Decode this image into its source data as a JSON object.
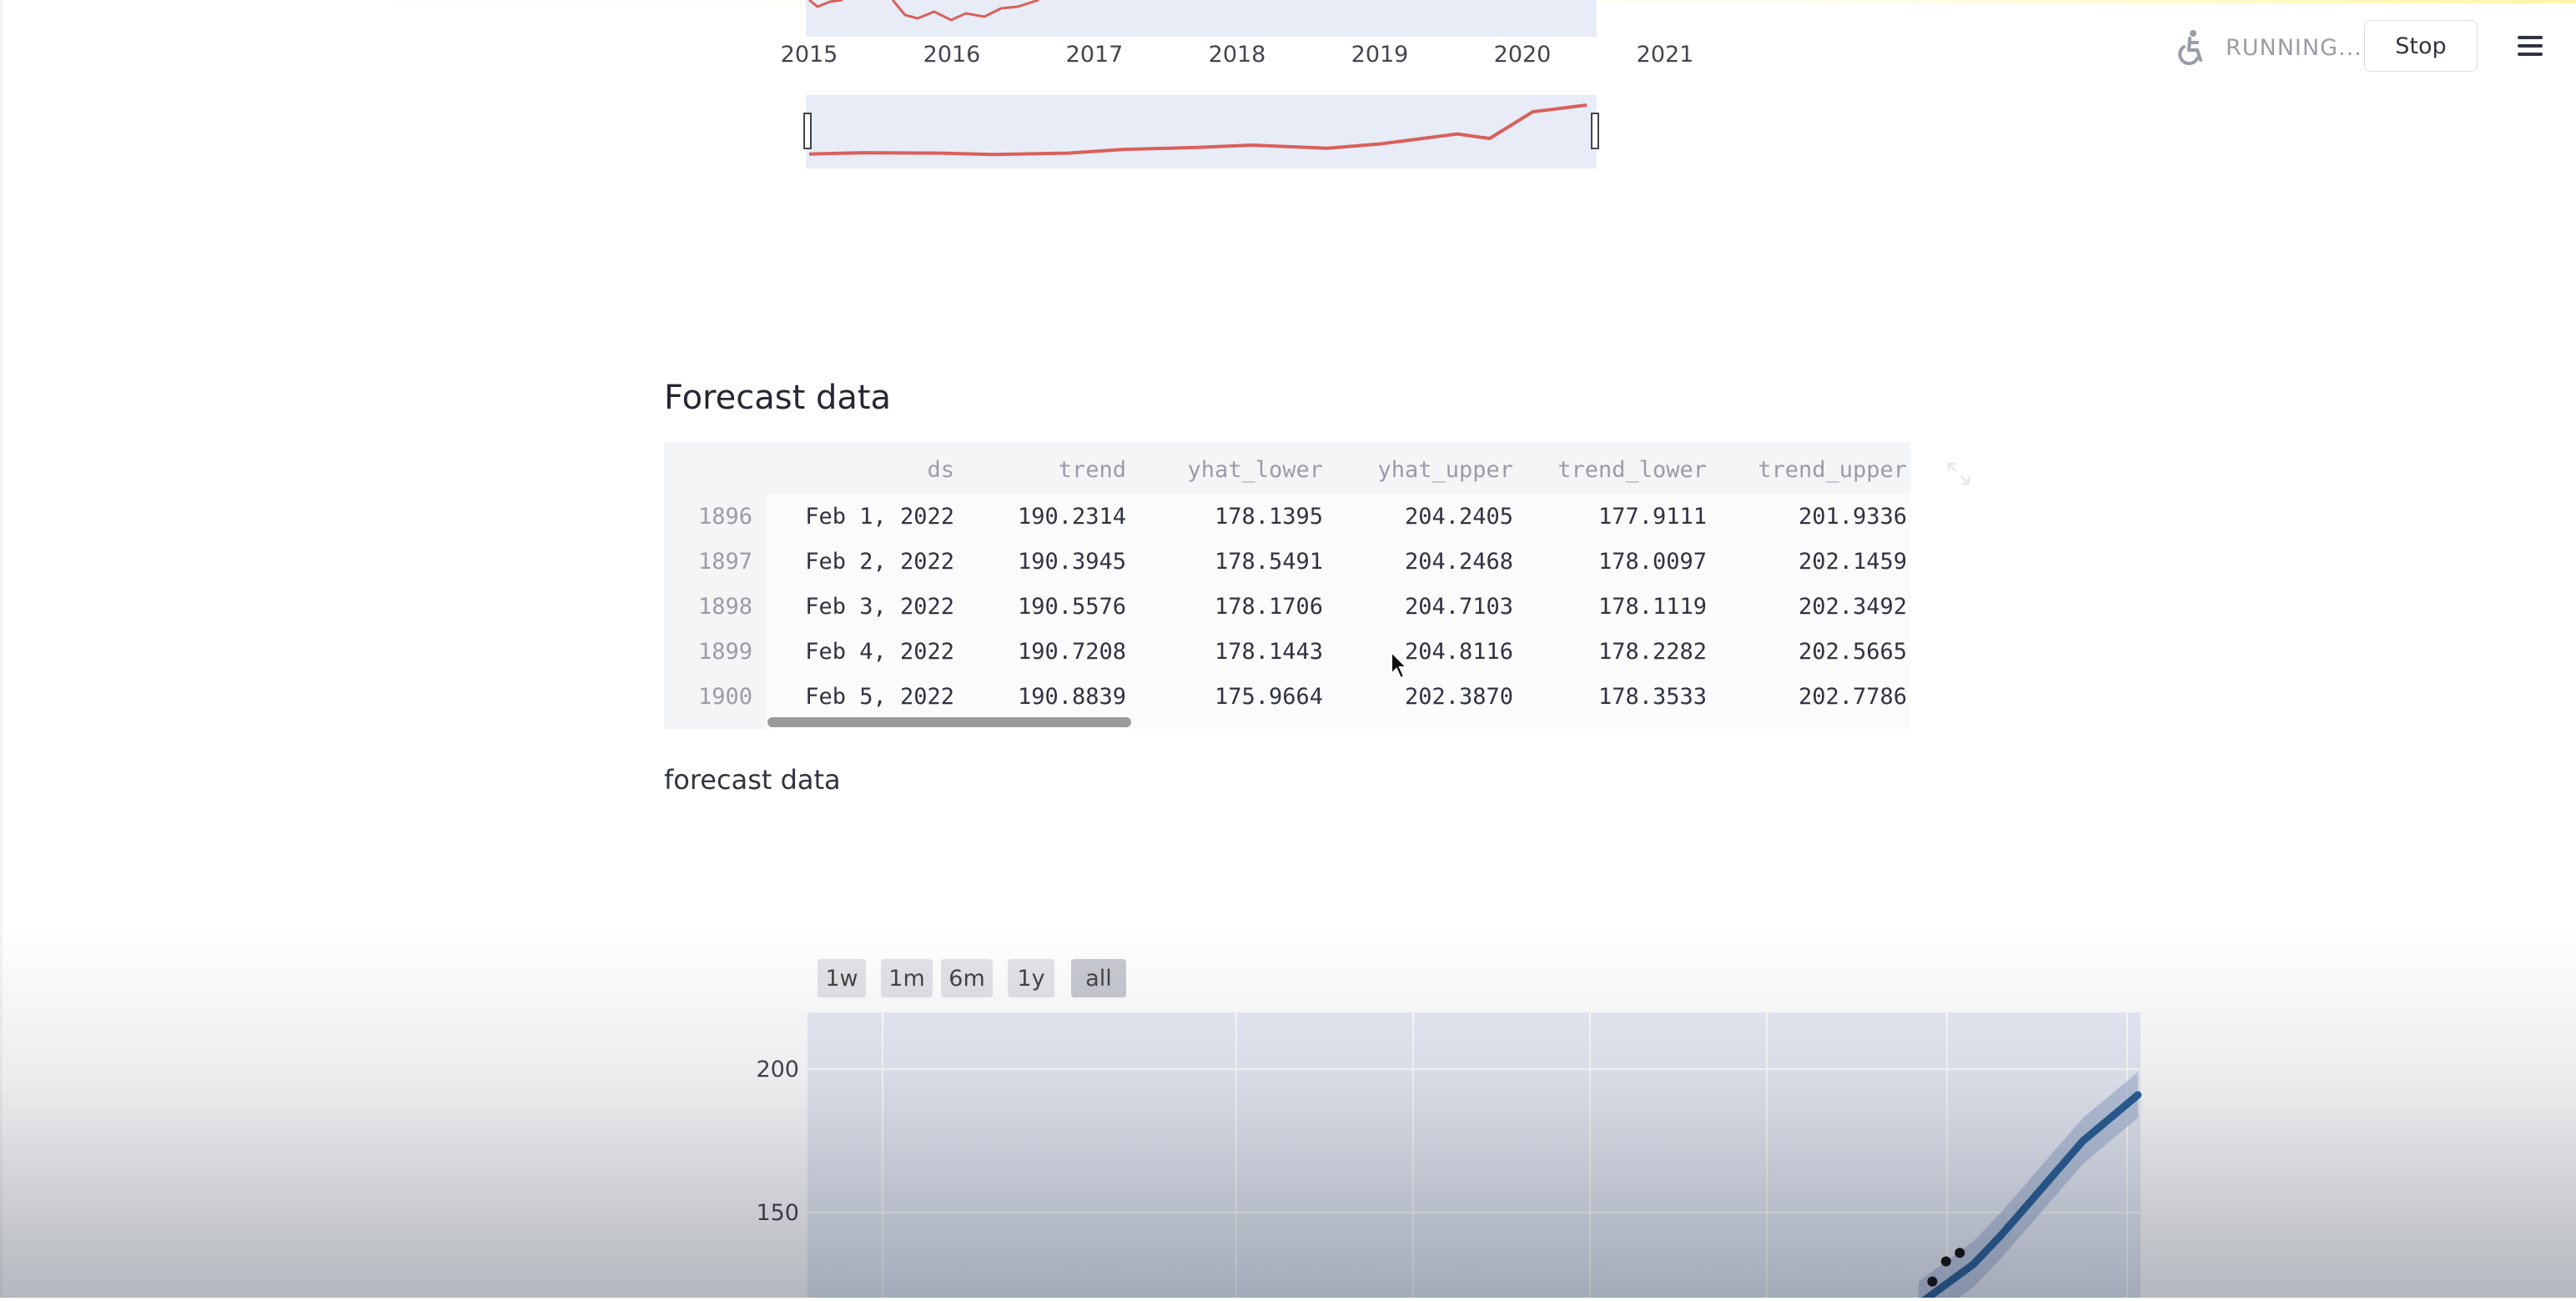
{
  "header": {
    "status": "RUNNING...",
    "stop_label": "Stop",
    "icons": [
      "accessibility-running-icon",
      "hamburger-menu-icon"
    ]
  },
  "section": {
    "title": "Forecast data",
    "caption": "forecast data"
  },
  "table": {
    "columns": [
      "",
      "ds",
      "trend",
      "yhat_lower",
      "yhat_upper",
      "trend_lower",
      "trend_upper"
    ],
    "rows": [
      [
        "1896",
        "Feb 1, 2022",
        "190.2314",
        "178.1395",
        "204.2405",
        "177.9111",
        "201.9336"
      ],
      [
        "1897",
        "Feb 2, 2022",
        "190.3945",
        "178.5491",
        "204.2468",
        "178.0097",
        "202.1459"
      ],
      [
        "1898",
        "Feb 3, 2022",
        "190.5576",
        "178.1706",
        "204.7103",
        "178.1119",
        "202.3492"
      ],
      [
        "1899",
        "Feb 4, 2022",
        "190.7208",
        "178.1443",
        "204.8116",
        "178.2282",
        "202.5665"
      ],
      [
        "1900",
        "Feb 5, 2022",
        "190.8839",
        "175.9664",
        "202.3870",
        "178.3533",
        "202.7786"
      ]
    ]
  },
  "range_selector": [
    "1w",
    "1m",
    "6m",
    "1y",
    "all"
  ],
  "range_selector_active": "all",
  "chart_data": [
    {
      "type": "line",
      "x_ticks": [
        "2015",
        "2016",
        "2017",
        "2018",
        "2019",
        "2020",
        "2021"
      ],
      "colors": {
        "series": "#d9605a",
        "plot_bg": "#e8ecf6"
      },
      "rangeslider": true,
      "series": [
        {
          "x": [
            "2015-01",
            "2015-06",
            "2016-01",
            "2016-06",
            "2017-01",
            "2017-06",
            "2018-01",
            "2018-06",
            "2019-01",
            "2019-06",
            "2020-01",
            "2020-04",
            "2020-08",
            "2021-01"
          ],
          "values": [
            25,
            28,
            27,
            24,
            27,
            35,
            40,
            45,
            38,
            48,
            70,
            60,
            120,
            135
          ]
        }
      ]
    },
    {
      "type": "line",
      "y_ticks": [
        "150",
        "200"
      ],
      "colors": {
        "forecast": "#2a5f98",
        "band": "#a9b9d6",
        "actual": "#111111",
        "plot_bg": "#e8ecf6"
      },
      "series": [
        {
          "x": [
            "2020-10",
            "2020-12",
            "2021-02",
            "2021-04",
            "2021-06",
            "2021-08",
            "2021-10",
            "2021-12",
            "2022-02"
          ],
          "values": [
            118,
            125,
            132,
            142,
            153,
            164,
            175,
            183,
            191
          ]
        },
        {
          "x": [
            "2020-10",
            "2020-11",
            "2020-12",
            "2021-01"
          ],
          "values": [
            118,
            126,
            133,
            136
          ]
        }
      ]
    }
  ]
}
